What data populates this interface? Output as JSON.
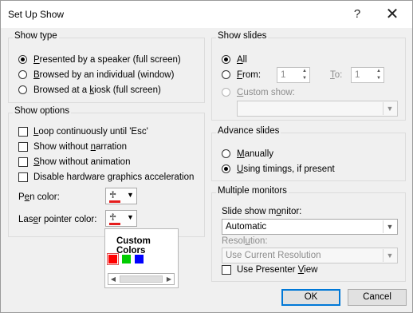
{
  "dialog": {
    "title": "Set Up Show",
    "help_label": "?",
    "close_label": "✕"
  },
  "show_type": {
    "legend": "Show type",
    "options": [
      {
        "pre": "",
        "key": "P",
        "post": "resented by a speaker (full screen)",
        "selected": true
      },
      {
        "pre": "",
        "key": "B",
        "post": "rowsed by an individual (window)",
        "selected": false
      },
      {
        "pre": "Browsed at a ",
        "key": "k",
        "post": "iosk (full screen)",
        "selected": false
      }
    ]
  },
  "show_options": {
    "legend": "Show options",
    "checks": [
      {
        "pre": "",
        "key": "L",
        "post": "oop continuously until 'Esc'",
        "checked": false
      },
      {
        "pre": "Show without ",
        "key": "n",
        "post": "arration",
        "checked": false
      },
      {
        "pre": "",
        "key": "S",
        "post": "how without animation",
        "checked": false
      },
      {
        "pre": "Disable hardware ",
        "key": "g",
        "post": "raphics acceleration",
        "checked": false
      }
    ],
    "pen_color_pre": "P",
    "pen_color_key": "e",
    "pen_color_post": "n color:",
    "laser_color_pre": "Las",
    "laser_color_key": "e",
    "laser_color_post": "r pointer color:",
    "pen_color": "#e51c1c",
    "laser_color": "#e51c1c"
  },
  "color_popup": {
    "title": "Custom Colors",
    "swatches": [
      "#ff0000",
      "#00cc00",
      "#0000ff"
    ],
    "selected_swatch": 0
  },
  "show_slides": {
    "legend": "Show slides",
    "all_key": "A",
    "all_post": "ll",
    "from_key": "F",
    "from_post": "rom:",
    "from_value": "1",
    "to_key": "T",
    "to_post": "o:",
    "to_value": "1",
    "custom_key": "C",
    "custom_post": "ustom show:",
    "selected": "all"
  },
  "advance_slides": {
    "legend": "Advance slides",
    "manual_key": "M",
    "manual_post": "anually",
    "timings_key": "U",
    "timings_post": "sing timings, if present",
    "selected": "timings"
  },
  "monitors": {
    "legend": "Multiple monitors",
    "monitor_pre": "Slide show m",
    "monitor_key": "o",
    "monitor_post": "nitor:",
    "monitor_value": "Automatic",
    "resolution_pre": "Resol",
    "resolution_key": "u",
    "resolution_post": "tion:",
    "resolution_value": "Use Current Resolution",
    "presenter_pre": "Use Presenter ",
    "presenter_key": "V",
    "presenter_post": "iew",
    "presenter_checked": false
  },
  "buttons": {
    "ok": "OK",
    "cancel": "Cancel"
  }
}
